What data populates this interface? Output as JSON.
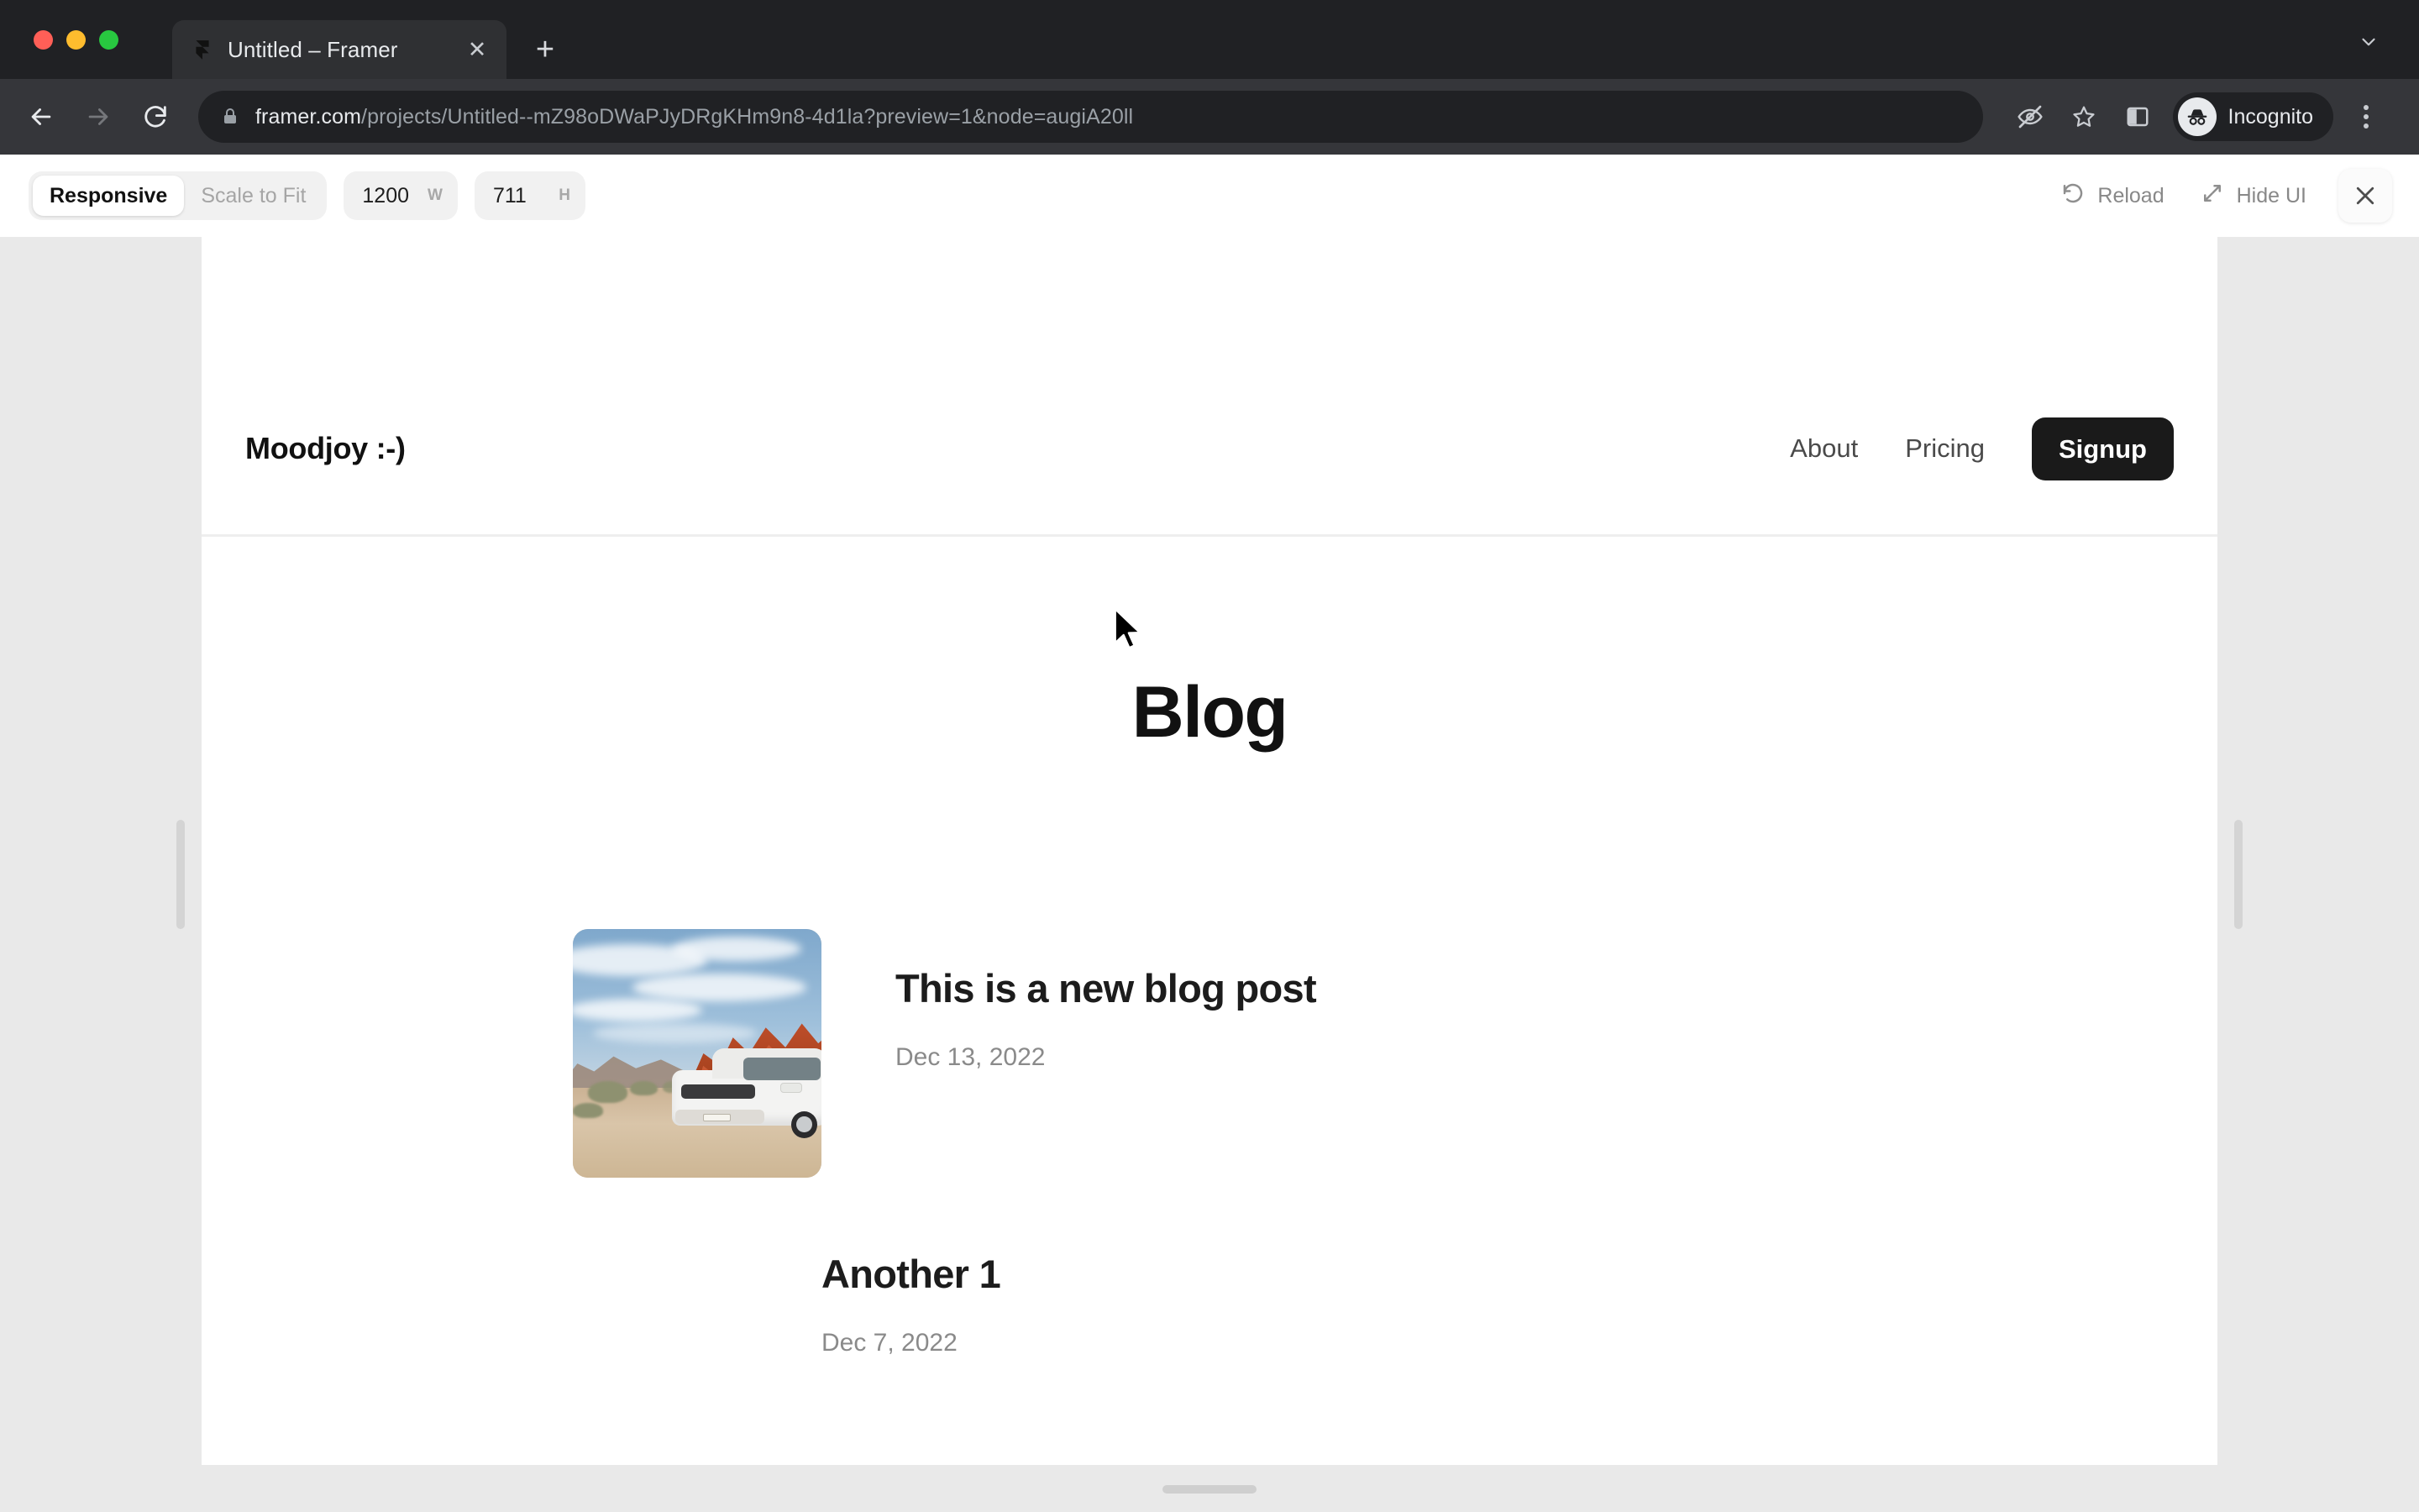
{
  "browser": {
    "tab": {
      "title": "Untitled – Framer",
      "favicon_icon": "framer-logo-icon",
      "close_icon": "close-icon"
    },
    "new_tab_icon": "plus-icon",
    "tabstrip_chevron_icon": "chevron-down-icon",
    "nav": {
      "back_icon": "arrow-left-icon",
      "forward_icon": "arrow-right-icon",
      "reload_icon": "reload-icon"
    },
    "omnibox": {
      "lock_icon": "lock-icon",
      "url_domain": "framer.com",
      "url_path": "/projects/Untitled--mZ98oDWaPJyDRgKHm9n8-4d1la?preview=1&node=augiA20ll"
    },
    "toolbar_icons": {
      "eye_off_icon": "eye-off-icon",
      "bookmark_icon": "star-icon",
      "side_panel_icon": "side-panel-icon",
      "incognito_icon": "incognito-icon",
      "menu_icon": "kebab-menu-icon"
    },
    "profile_label": "Incognito"
  },
  "framer_toolbar": {
    "modes": [
      {
        "label": "Responsive",
        "active": true
      },
      {
        "label": "Scale to Fit",
        "active": false
      }
    ],
    "width": {
      "value": "1200",
      "unit": "W"
    },
    "height": {
      "value": "711",
      "unit": "H"
    },
    "reload": {
      "label": "Reload",
      "icon": "reload-icon"
    },
    "hide_ui": {
      "label": "Hide UI",
      "icon": "expand-arrow-icon"
    },
    "close": {
      "icon": "close-icon"
    }
  },
  "site": {
    "nav": {
      "logo": "Moodjoy :-)",
      "links": [
        {
          "label": "About"
        },
        {
          "label": "Pricing"
        }
      ],
      "cta": {
        "label": "Signup"
      }
    },
    "page_title": "Blog",
    "posts": [
      {
        "title": "This is a new blog post",
        "date": "Dec 13, 2022",
        "thumbnail": "desert-suv-photo",
        "has_thumbnail": true
      },
      {
        "title": "Another 1",
        "date": "Dec 7, 2022",
        "has_thumbnail": false
      }
    ]
  },
  "colors": {
    "browser_chrome": "#202124",
    "browser_toolbar": "#35363a",
    "canvas_background": "#e9e9e9",
    "cta_background": "#1a1a1a",
    "text_primary": "#111111",
    "text_muted": "#8a8a8a"
  }
}
